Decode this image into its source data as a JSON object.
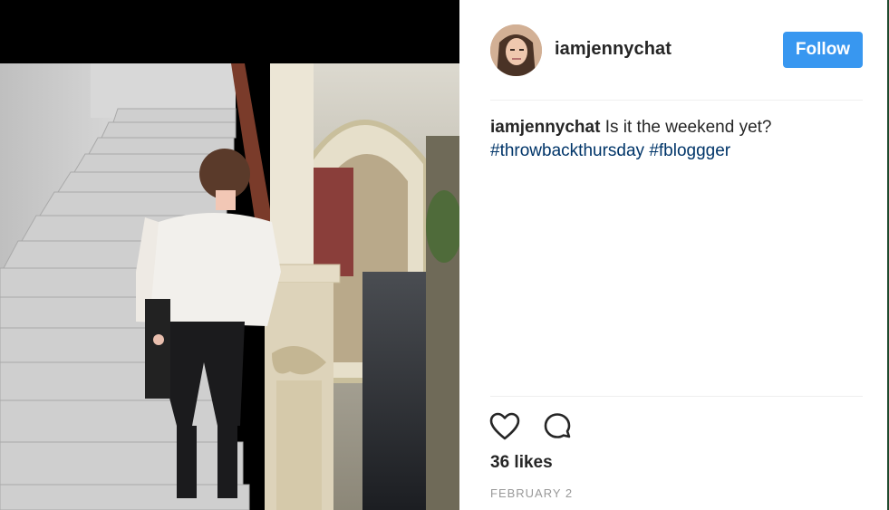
{
  "post": {
    "photo_alt_icon": "post-photo",
    "username": "iamjennychat",
    "follow_label": "Follow",
    "caption_username": "iamjennychat",
    "caption_text": " Is it the weekend yet? ",
    "hashtags": [
      "#throwbackthursday",
      "#fbloggger"
    ],
    "likes": "36 likes",
    "date": "FEBRUARY 2"
  },
  "icons": {
    "like": "heart-icon",
    "comment": "comment-icon"
  },
  "colors": {
    "follow_button": "#3897f0",
    "hashtag": "#003569",
    "text": "#262626",
    "date": "#999999"
  }
}
